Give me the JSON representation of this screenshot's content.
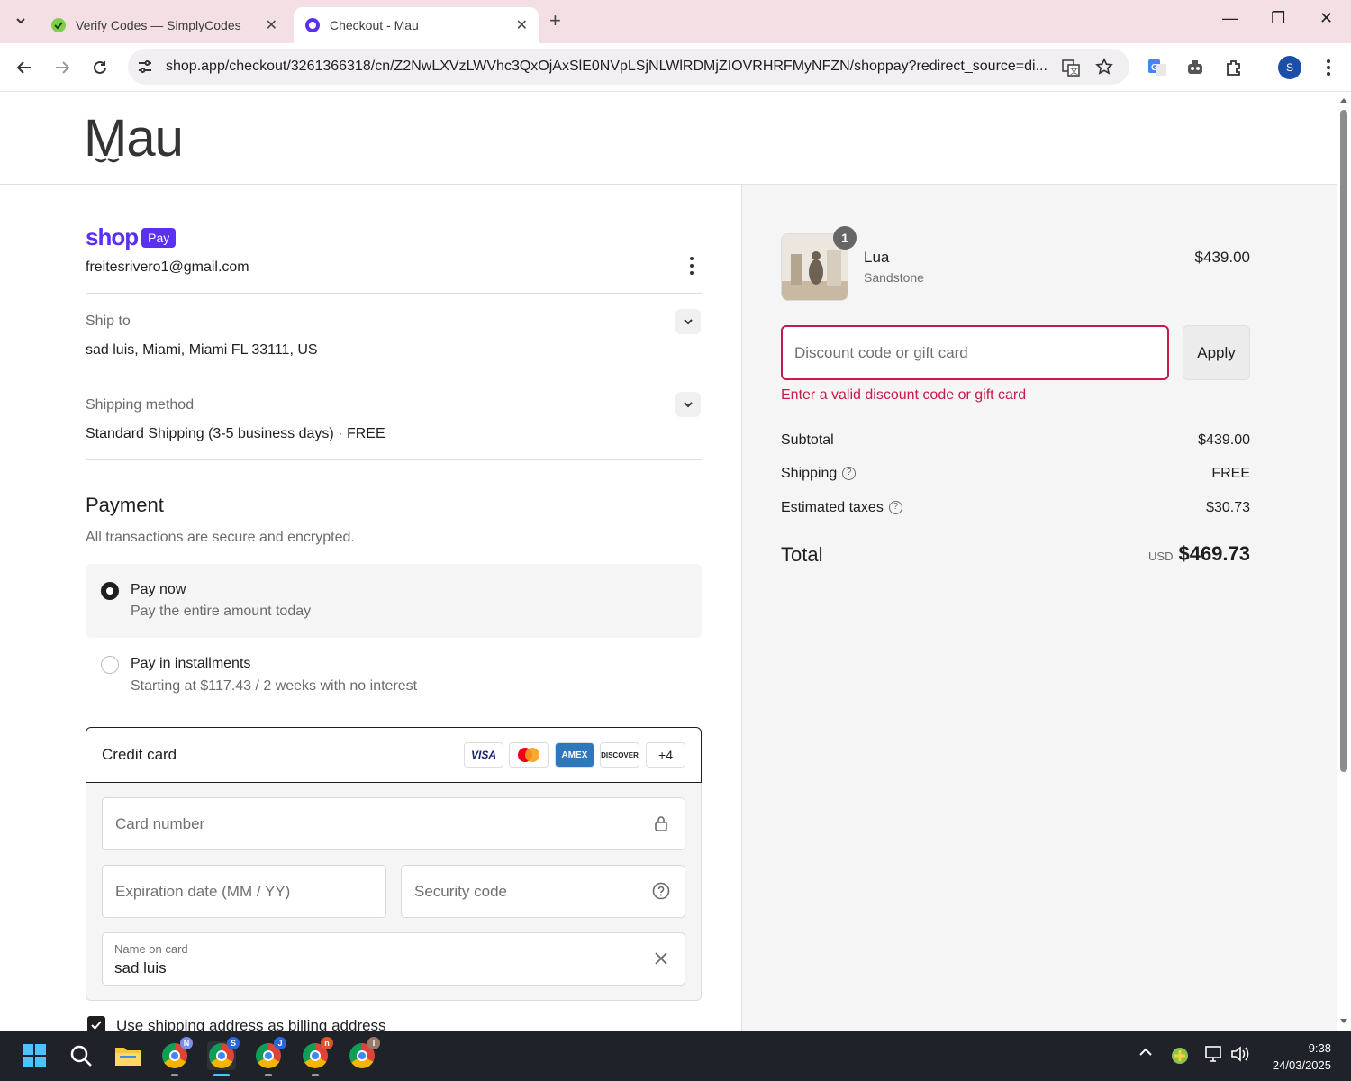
{
  "browser": {
    "tabs": [
      {
        "title": "Verify Codes — SimplyCodes",
        "active": false
      },
      {
        "title": "Checkout - Mau",
        "active": true
      }
    ],
    "url": "shop.app/checkout/3261366318/cn/Z2NwLXVzLWVhc3QxOjAxSlE0NVpLSjNLWlRDMjZIOVRHRFMyNFZN/shoppay?redirect_source=di...",
    "profile_initial": "S"
  },
  "store": {
    "name": "Mau"
  },
  "shop_pay": {
    "brand_word": "shop",
    "badge": "Pay",
    "email": "freitesrivero1@gmail.com"
  },
  "ship_to": {
    "label": "Ship to",
    "value": "sad luis, Miami, Miami FL 33111, US"
  },
  "shipping_method": {
    "label": "Shipping method",
    "value": "Standard Shipping (3-5 business days) · FREE"
  },
  "payment": {
    "heading": "Payment",
    "subheading": "All transactions are secure and encrypted.",
    "options": [
      {
        "title": "Pay now",
        "subtitle": "Pay the entire amount today",
        "selected": true
      },
      {
        "title": "Pay in installments",
        "subtitle": "Starting at $117.43 / 2 weeks with no interest",
        "selected": false
      }
    ],
    "credit_card": {
      "label": "Credit card",
      "brands": [
        "VISA",
        "Mastercard",
        "AMEX",
        "DISCOVER"
      ],
      "more": "+4",
      "card_number_placeholder": "Card number",
      "expiration_placeholder": "Expiration date (MM / YY)",
      "security_placeholder": "Security code",
      "name_label": "Name on card",
      "name_value": "sad luis"
    },
    "billing_checkbox": "Use shipping address as billing address"
  },
  "order": {
    "item": {
      "name": "Lua",
      "variant": "Sandstone",
      "price": "$439.00",
      "quantity": "1"
    },
    "discount": {
      "placeholder": "Discount code or gift card",
      "value": "",
      "apply": "Apply",
      "error": "Enter a valid discount code or gift card"
    },
    "subtotal_label": "Subtotal",
    "subtotal": "$439.00",
    "shipping_label": "Shipping",
    "shipping": "FREE",
    "taxes_label": "Estimated taxes",
    "taxes": "$30.73",
    "total_label": "Total",
    "currency": "USD",
    "total": "$469.73"
  },
  "taskbar": {
    "time": "9:38",
    "date": "24/03/2025",
    "chrome_badges": [
      {
        "letter": "N",
        "color": "#7c8cf0"
      },
      {
        "letter": "S",
        "color": "#2b66d9"
      },
      {
        "letter": "J",
        "color": "#2b66d9"
      },
      {
        "letter": "n",
        "color": "#d9562b"
      },
      {
        "letter": "I",
        "color": "#9c7a6a"
      }
    ]
  },
  "colors": {
    "shop_purple": "#5a31f4",
    "error_red": "#c9184a",
    "tab_strip": "#f3dfe4"
  }
}
